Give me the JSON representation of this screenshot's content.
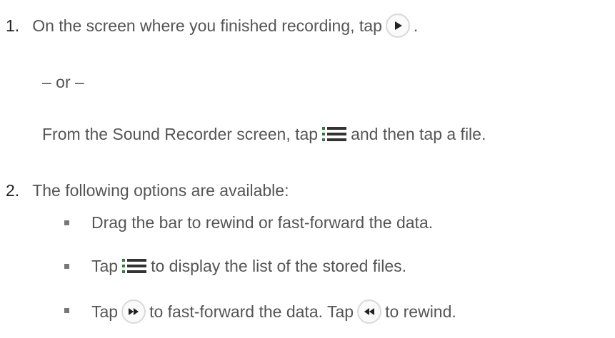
{
  "steps": [
    {
      "number": "1.",
      "line1_before": "On the screen where you finished recording, tap",
      "line1_after": ".",
      "or_text": "– or –",
      "line2_before": "From the Sound Recorder screen, tap",
      "line2_after": "and then tap a file."
    },
    {
      "number": "2.",
      "intro": "The following options are available:",
      "bullets": [
        {
          "text": "Drag the bar to rewind or fast-forward the data."
        },
        {
          "before": "Tap",
          "after": "to display the list of the stored files."
        },
        {
          "before": "Tap",
          "middle": "to fast-forward the data. Tap",
          "after": "to rewind."
        }
      ]
    }
  ],
  "icons": {
    "play": "play-icon",
    "list": "list-icon",
    "fast_forward": "fast-forward-icon",
    "rewind": "rewind-icon"
  },
  "colors": {
    "text": "#555555",
    "number": "#222222",
    "icon": "#222222",
    "list_icon": "#2e7d32"
  }
}
